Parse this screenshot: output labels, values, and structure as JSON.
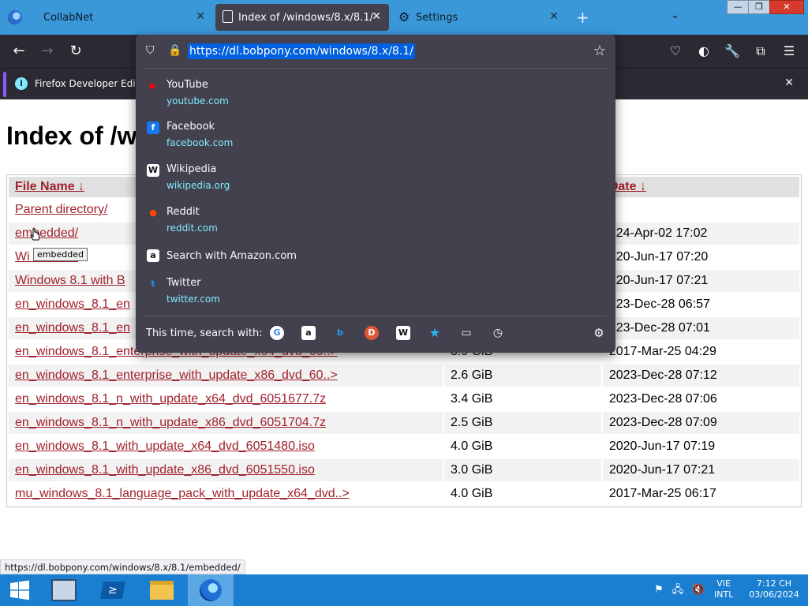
{
  "tabs": [
    {
      "label": "CollabNet"
    },
    {
      "label": "Index of /windows/8.x/8.1/"
    },
    {
      "label": "Settings"
    }
  ],
  "window_controls": {
    "minimize": "—",
    "restore": "❐",
    "close": "✕"
  },
  "navbar": {
    "back_icon": "back-arrow-icon",
    "forward_icon": "forward-arrow-icon",
    "reload_icon": "reload-icon"
  },
  "url": {
    "value": "https://dl.bobpony.com/windows/8.x/8.1/"
  },
  "suggestions": [
    {
      "title": "YouTube",
      "url": "youtube.com",
      "color": "#ff0000",
      "glyph": "▶"
    },
    {
      "title": "Facebook",
      "url": "facebook.com",
      "color": "#1877f2",
      "glyph": "f"
    },
    {
      "title": "Wikipedia",
      "url": "wikipedia.org",
      "color": "#ffffff",
      "glyph": "W"
    },
    {
      "title": "Reddit",
      "url": "reddit.com",
      "color": "#ff4500",
      "glyph": "●"
    },
    {
      "title": "Search with Amazon.com",
      "url": "",
      "color": "#ffffff",
      "glyph": "a"
    },
    {
      "title": "Twitter",
      "url": "twitter.com",
      "color": "#1d9bf0",
      "glyph": "t"
    }
  ],
  "oneoff": {
    "label": "This time, search with:",
    "engines": [
      "google",
      "amazon",
      "bing",
      "duckduckgo",
      "wikipedia",
      "bookmarks",
      "tabs",
      "history"
    ]
  },
  "notification": {
    "text": "Firefox Developer Edition"
  },
  "page": {
    "heading": "Index of /w",
    "headers": {
      "name": "File Name  ↓",
      "date": "Date  ↓"
    },
    "rows": [
      {
        "name": "Parent directory/",
        "size": "",
        "date": ""
      },
      {
        "name": "embedded/",
        "size": "",
        "date": "024-Apr-02 17:02"
      },
      {
        "name": "Wi          1 with B",
        "size": "",
        "date": "020-Jun-17 07:20"
      },
      {
        "name": "Windows 8.1 with B",
        "size": "",
        "date": "020-Jun-17 07:21"
      },
      {
        "name": "en_windows_8.1_en",
        "size": "",
        "date": "023-Dec-28 06:57"
      },
      {
        "name": "en_windows_8.1_en",
        "size": "",
        "date": "023-Dec-28 07:01"
      },
      {
        "name": "en_windows_8.1_enterprise_with_update_x64_dvd_60..>",
        "size": "3.9 GiB",
        "date": "2017-Mar-25 04:29"
      },
      {
        "name": "en_windows_8.1_enterprise_with_update_x86_dvd_60..>",
        "size": "2.6 GiB",
        "date": "2023-Dec-28 07:12"
      },
      {
        "name": "en_windows_8.1_n_with_update_x64_dvd_6051677.7z",
        "size": "3.4 GiB",
        "date": "2023-Dec-28 07:06"
      },
      {
        "name": "en_windows_8.1_n_with_update_x86_dvd_6051704.7z",
        "size": "2.5 GiB",
        "date": "2023-Dec-28 07:09"
      },
      {
        "name": "en_windows_8.1_with_update_x64_dvd_6051480.iso",
        "size": "4.0 GiB",
        "date": "2020-Jun-17 07:19"
      },
      {
        "name": "en_windows_8.1_with_update_x86_dvd_6051550.iso",
        "size": "3.0 GiB",
        "date": "2020-Jun-17 07:21"
      },
      {
        "name": "mu_windows_8.1_language_pack_with_update_x64_dvd..>",
        "size": "4.0 GiB",
        "date": "2017-Mar-25 06:17"
      }
    ]
  },
  "tooltip": "embedded",
  "status_url": "https://dl.bobpony.com/windows/8.x/8.1/embedded/",
  "taskbar": {
    "lang_line1": "VIE",
    "lang_line2": "INTL",
    "time": "7:12 CH",
    "date": "03/06/2024"
  },
  "colors": {
    "tabbar": "#3a98d8",
    "toolbar": "#2b2a33",
    "panel": "#42414d",
    "link": "#a0222c",
    "url_highlight": "#0060df",
    "suggestion_url": "#80ebff",
    "taskbar": "#1a7fd0"
  }
}
